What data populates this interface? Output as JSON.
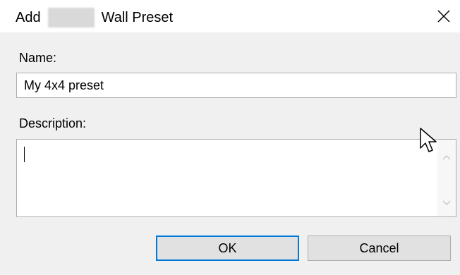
{
  "window": {
    "title_prefix": "Add",
    "title_suffix": "Wall Preset",
    "close_glyph": "✕"
  },
  "form": {
    "name_label": "Name:",
    "name_value": "My 4x4 preset",
    "description_label": "Description:",
    "description_value": ""
  },
  "buttons": {
    "ok_label": "OK",
    "cancel_label": "Cancel"
  },
  "colors": {
    "default_button_border": "#0078d7",
    "button_face": "#e1e1e1",
    "dialog_background": "#f0f0f0"
  },
  "icons": {
    "close": "close-icon",
    "scroll_up": "chevron-up-icon",
    "scroll_down": "chevron-down-icon",
    "pointer": "mouse-pointer-icon"
  }
}
